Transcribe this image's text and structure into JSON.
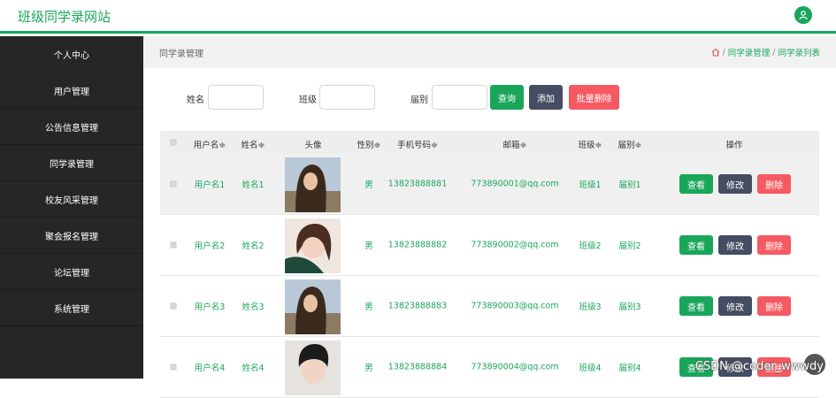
{
  "header": {
    "site_title": "班级同学录网站",
    "user_icon": "user-icon"
  },
  "sidebar": {
    "items": [
      {
        "label": "个人中心"
      },
      {
        "label": "用户管理"
      },
      {
        "label": "公告信息管理"
      },
      {
        "label": "同学录管理"
      },
      {
        "label": "校友风采管理"
      },
      {
        "label": "聚会报名管理"
      },
      {
        "label": "论坛管理"
      },
      {
        "label": "系统管理"
      }
    ]
  },
  "breadcrumb": {
    "title": "同学录管理",
    "path": [
      "同学录管理",
      "同学录列表"
    ],
    "separator": "/"
  },
  "search": {
    "name_label": "姓名",
    "name_value": "",
    "class_label": "班级",
    "class_value": "",
    "grade_label": "届别",
    "grade_value": "",
    "query_btn": "查询",
    "add_btn": "添加",
    "batch_delete_btn": "批量删除"
  },
  "table": {
    "columns": [
      "用户名≑",
      "姓名≑",
      "头像",
      "性别≑",
      "手机号码≑",
      "邮箱≑",
      "班级≑",
      "届别≑",
      "操作"
    ],
    "rows": [
      {
        "username": "用户名1",
        "name": "姓名1",
        "gender": "男",
        "phone": "13823888881",
        "email": "773890001@qq.com",
        "class": "班级1",
        "grade": "届别1"
      },
      {
        "username": "用户名2",
        "name": "姓名2",
        "gender": "男",
        "phone": "13823888882",
        "email": "773890002@qq.com",
        "class": "班级2",
        "grade": "届别2"
      },
      {
        "username": "用户名3",
        "name": "姓名3",
        "gender": "男",
        "phone": "13823888883",
        "email": "773890003@qq.com",
        "class": "班级3",
        "grade": "届别3"
      },
      {
        "username": "用户名4",
        "name": "姓名4",
        "gender": "男",
        "phone": "13823888884",
        "email": "773890004@qq.com",
        "class": "班级4",
        "grade": "届别4"
      }
    ],
    "actions": {
      "view": "查看",
      "edit": "修改",
      "delete": "删除"
    }
  },
  "watermark": "CSDN @coder_wwwdy",
  "colors": {
    "accent": "#19a65b",
    "edit": "#454d62",
    "danger": "#f55a63",
    "sidebar": "#262626"
  }
}
